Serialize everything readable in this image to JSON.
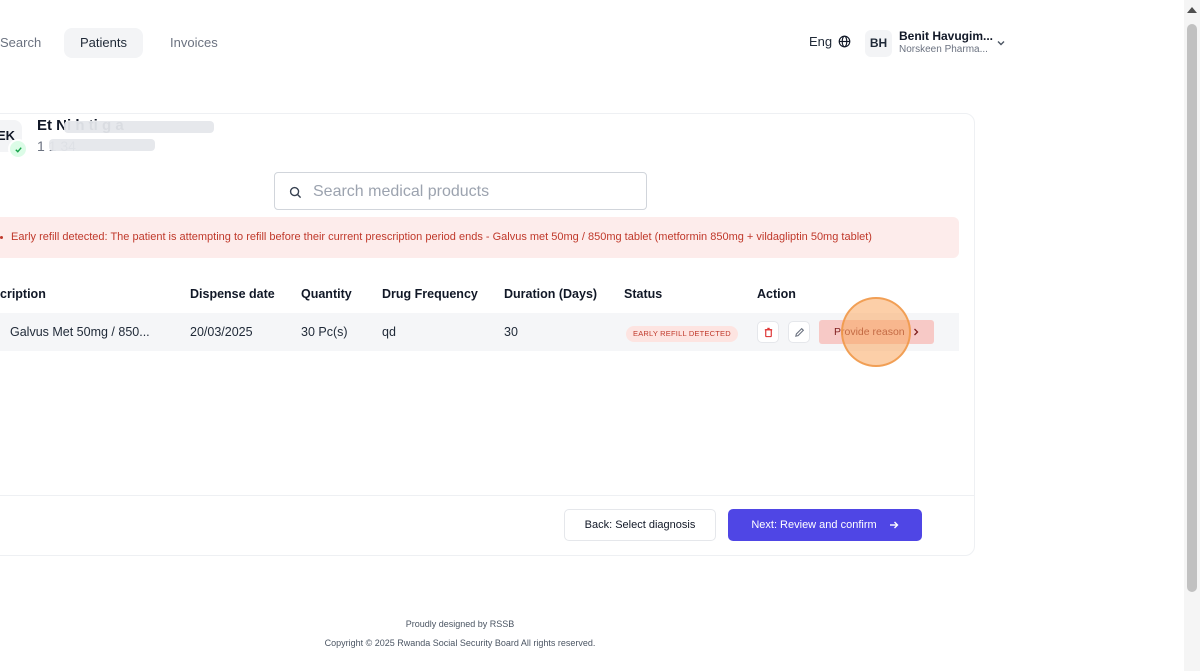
{
  "nav": {
    "search_label": "Search",
    "patients_label": "Patients",
    "invoices_label": "Invoices",
    "language": "Eng",
    "user_initials": "BH",
    "user_name": "Benit Havugim...",
    "user_org": "Norskeen Pharma..."
  },
  "patient": {
    "initials": "EK",
    "name": "Et           Ni       h      ti    g   a",
    "id": "1 1         34"
  },
  "search": {
    "placeholder": "Search medical products"
  },
  "alert": {
    "text": "Early refill detected: The patient is attempting to refill before their current prescription period ends - Galvus met 50mg / 850mg tablet (metformin 850mg + vildagliptin 50mg tablet)"
  },
  "table": {
    "headers": [
      "cription",
      "Dispense date",
      "Quantity",
      "Drug Frequency",
      "Duration (Days)",
      "Status",
      "Action"
    ],
    "rows": [
      {
        "prescription": "Galvus Met 50mg / 850...",
        "dispense_date": "20/03/2025",
        "quantity": "30 Pc(s)",
        "frequency": "qd",
        "duration": "30",
        "status": "EARLY REFILL DETECTED",
        "action_label": "Provide reason"
      }
    ]
  },
  "actions": {
    "back_label": "Back: Select diagnosis",
    "next_label": "Next: Review and confirm"
  },
  "footer": {
    "designed_by": "Proudly designed by RSSB",
    "copyright": "Copyright © 2025 Rwanda Social Security Board All rights reserved."
  },
  "colors": {
    "primary": "#4f46e5",
    "alert_bg": "#fdeceb",
    "alert_text": "#c0392b",
    "reason_button": "#f7c9c6"
  }
}
